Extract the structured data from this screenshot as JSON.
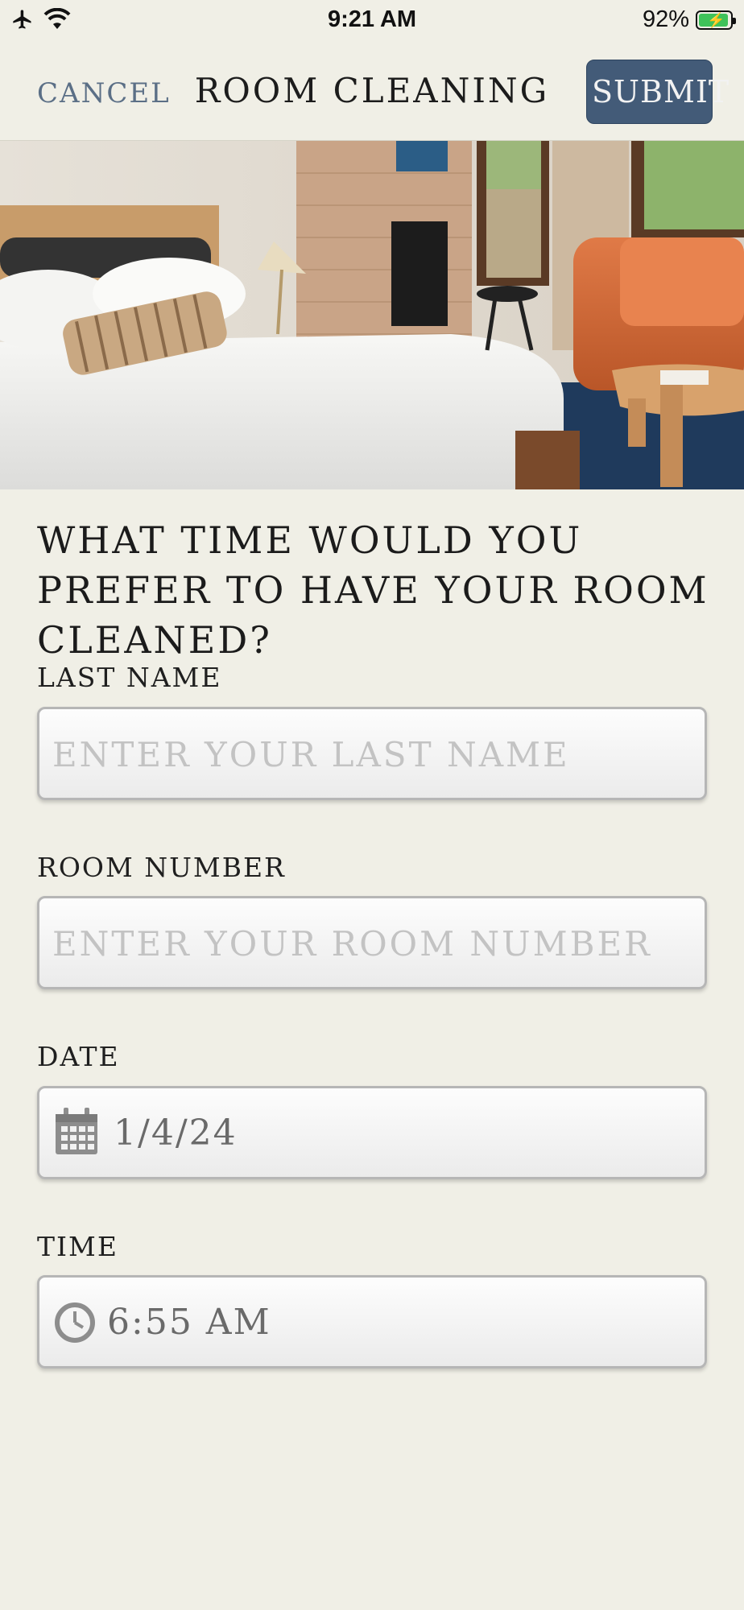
{
  "status_bar": {
    "time": "9:21 AM",
    "battery": "92%",
    "icons": [
      "airplane-icon",
      "wifi-icon",
      "battery-charging-icon"
    ]
  },
  "nav": {
    "cancel_label": "CANCEL",
    "title": "ROOM CLEANING",
    "submit_label": "SUBMIT"
  },
  "hero": {
    "icon": "hotel-room-photo"
  },
  "question": "WHAT TIME WOULD YOU PREFER TO HAVE YOUR ROOM CLEANED?",
  "form": {
    "last_name": {
      "label": "LAST NAME",
      "placeholder": "ENTER YOUR LAST NAME",
      "value": ""
    },
    "room_number": {
      "label": "ROOM NUMBER",
      "placeholder": "ENTER YOUR ROOM NUMBER",
      "value": ""
    },
    "date": {
      "label": "DATE",
      "value": "1/4/24",
      "icon": "calendar-icon"
    },
    "time": {
      "label": "TIME",
      "value": "6:55 AM",
      "icon": "clock-icon"
    }
  },
  "colors": {
    "background": "#f0efe6",
    "accent": "#435b78",
    "cancel": "#5b6f86"
  }
}
